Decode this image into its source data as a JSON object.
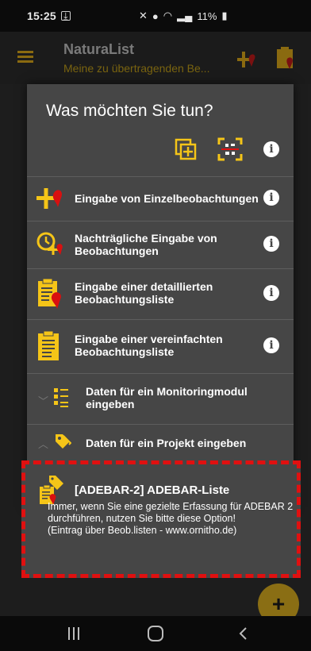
{
  "status_bar": {
    "time": "15:25",
    "battery": "11%"
  },
  "app_bar": {
    "title": "NaturaList",
    "subtitle": "Meine zu übertragenden Be..."
  },
  "dialog": {
    "title": "Was möchten Sie tun?",
    "items": [
      {
        "label": "Eingabe von Einzelbeobachtungen"
      },
      {
        "label": "Nachträgliche Eingabe von Beobachtungen"
      },
      {
        "label": "Eingabe einer detaillierten Beobachtungsliste"
      },
      {
        "label": "Eingabe einer vereinfachten Beobachtungsliste"
      }
    ],
    "expandables": [
      {
        "label": "Daten für ein Monitoringmodul eingeben",
        "state": "collapsed"
      },
      {
        "label": "Daten für ein Projekt eingeben",
        "state": "expanded"
      }
    ]
  },
  "project_card": {
    "title": "[ADEBAR-2] ADEBAR-Liste",
    "description": "Immer, wenn Sie eine gezielte Erfassung für ADEBAR 2 durchführen, nutzen Sie bitte diese Option!",
    "note": "(Eintrag über Beob.listen - www.ornitho.de)"
  },
  "fab": {
    "symbol": "+"
  },
  "colors": {
    "accent_yellow": "#f5c518",
    "accent_red": "#d81010",
    "dialog_bg": "#464646",
    "highlight_border": "#e01010"
  }
}
